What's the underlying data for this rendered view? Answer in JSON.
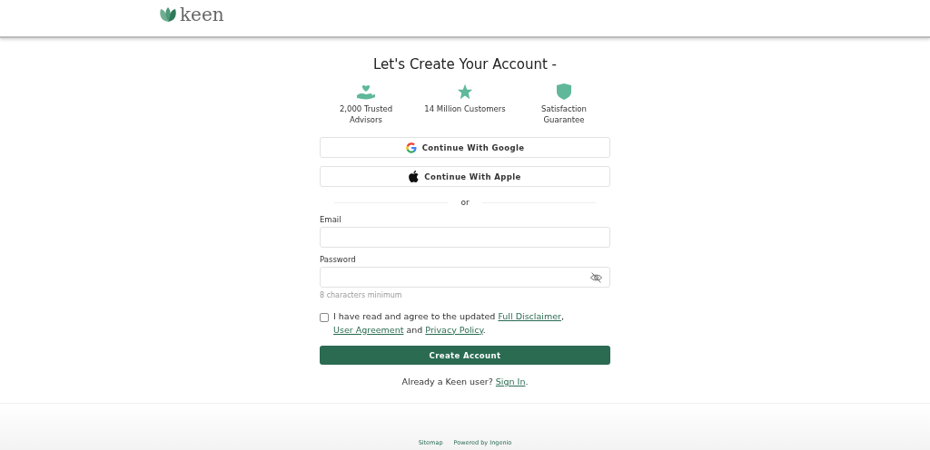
{
  "header": {
    "logo_text": "keen"
  },
  "title": "Let's Create Your Account -",
  "features": [
    {
      "kind": "hand-heart",
      "label": "2,000 Trusted Advisors"
    },
    {
      "kind": "star",
      "label": "14 Million Customers"
    },
    {
      "kind": "shield",
      "label": "Satisfaction Guarantee"
    }
  ],
  "social_buttons": [
    {
      "kind": "google",
      "label": "Continue With Google"
    },
    {
      "kind": "apple",
      "label": "Continue With Apple"
    }
  ],
  "divider": "or",
  "fields": [
    {
      "label": "Email",
      "kind": "text"
    },
    {
      "label": "Password",
      "kind": "password",
      "hint": "8 characters minimum"
    }
  ],
  "agreement": {
    "checked": false,
    "parts": [
      {
        "kind": "text",
        "text": "I have read and agree to the updated "
      },
      {
        "kind": "link",
        "text": "Full Disclaimer"
      },
      {
        "kind": "text",
        "text": ", "
      },
      {
        "kind": "link",
        "text": "User Agreement"
      },
      {
        "kind": "text",
        "text": " and "
      },
      {
        "kind": "link",
        "text": "Privacy Policy"
      },
      {
        "kind": "text",
        "text": "."
      }
    ]
  },
  "submit": "Create Account",
  "signin": {
    "text": "Already a Keen user? ",
    "link": "Sign In",
    "after": "."
  },
  "footer": [
    "Sitemap",
    "Powered by Ingenio"
  ]
}
